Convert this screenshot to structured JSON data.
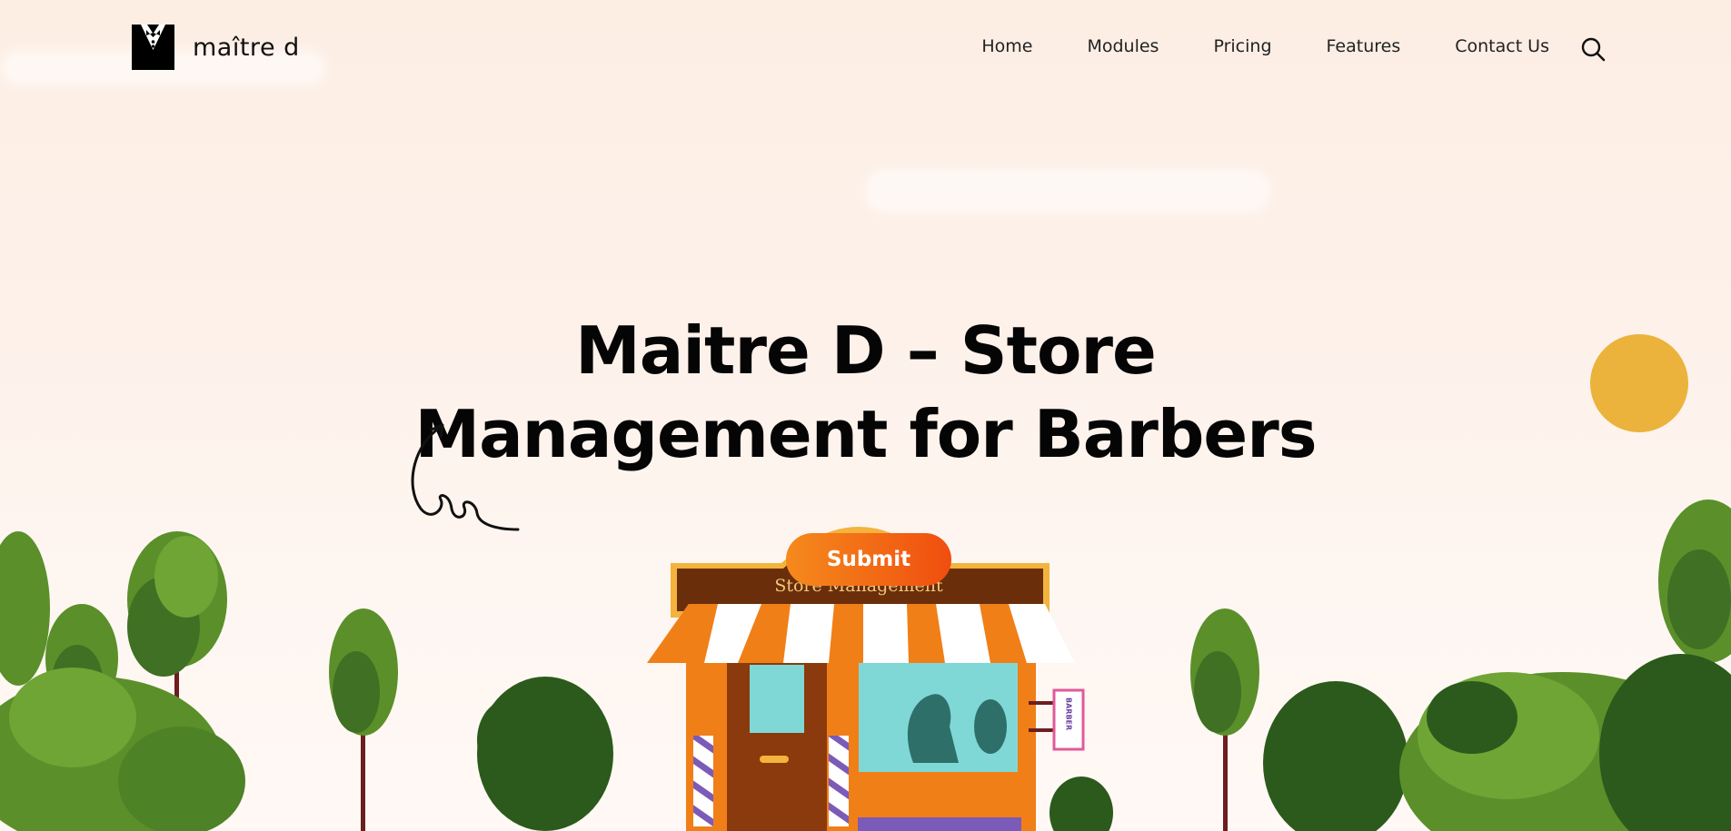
{
  "brand": {
    "name": "maître d"
  },
  "nav": {
    "items": [
      {
        "label": "Home"
      },
      {
        "label": "Modules"
      },
      {
        "label": "Pricing"
      },
      {
        "label": "Features"
      },
      {
        "label": "Contact Us"
      }
    ],
    "search_icon": "search-icon"
  },
  "hero": {
    "title_line1": "Maitre D – Store",
    "title_line2": "Management for Barbers",
    "submit_label": "Submit",
    "sign_text": "Store Management",
    "barber_sign": "BARBER"
  },
  "colors": {
    "sun": "#ebb33b",
    "accent_orange": "#f58a1c",
    "accent_red": "#f04e0f",
    "tree_light": "#5b8f2a",
    "tree_dark": "#2b5a1c"
  }
}
